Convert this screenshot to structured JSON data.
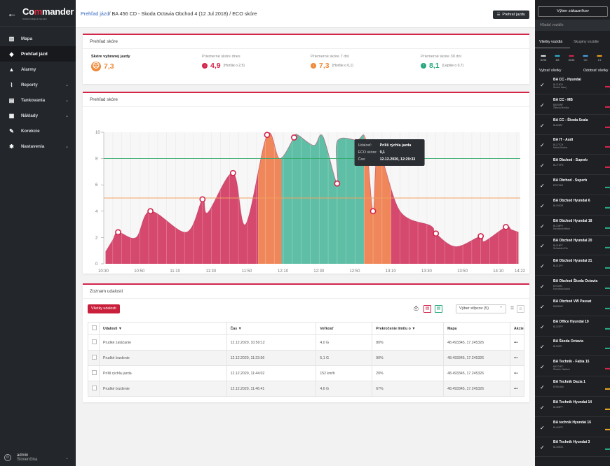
{
  "sidebar": {
    "brand_a": "Co",
    "brand_r": "m",
    "brand_b": "mander",
    "tagline": "Global Intelligent Operator",
    "items": [
      {
        "label": "Mapa",
        "icon": "map-icon"
      },
      {
        "label": "Prehľad jázd",
        "icon": "car-icon"
      },
      {
        "label": "Alarmy",
        "icon": "bell-icon"
      },
      {
        "label": "Reporty",
        "icon": "chart-icon"
      },
      {
        "label": "Tankovania",
        "icon": "fuel-icon"
      },
      {
        "label": "Náklady",
        "icon": "document-icon"
      },
      {
        "label": "Korekcie",
        "icon": "wrench-icon"
      },
      {
        "label": "Nastavenia",
        "icon": "gear-icon"
      }
    ],
    "user": {
      "name": "admin",
      "locale": "Slovenčina"
    }
  },
  "topbar": {
    "crumb_link": "Prehľad jázd",
    "crumb_rest": " / BA 456 CD - Skoda Octavia Obchod 4 (12 Jul 2018) / ECO skóre",
    "replay_button": "Prehrať jazdu"
  },
  "score_card": {
    "title": "Prehľad skóre",
    "cols": [
      {
        "label": "Skóre vybranej jazdy",
        "value": "7,3",
        "note": "",
        "color": "#ef8a3a"
      },
      {
        "label": "Priemerné skóre dnes",
        "value": "4,9",
        "note": "(Horšie o 2,5)",
        "color": "#d3244a"
      },
      {
        "label": "Priemerné skóre 7 dní",
        "value": "7,3",
        "note": "(Horšie o 0,1)",
        "color": "#ef8a3a"
      },
      {
        "label": "Priemerné skóre 30 dní",
        "value": "8,1",
        "note": "(Lepšie o 0,7)",
        "color": "#27a77e"
      }
    ]
  },
  "chart_card": {
    "title": "Prehľad skóre"
  },
  "chart_data": {
    "type": "area",
    "title": "",
    "xlabel": "",
    "ylabel": "",
    "ylim": [
      0,
      10
    ],
    "yticks": [
      0,
      2,
      4,
      6,
      8,
      10
    ],
    "xticks": [
      "10:30",
      "10:50",
      "11:10",
      "11:30",
      "11:50",
      "12:10",
      "12:30",
      "12:50",
      "13:10",
      "13:30",
      "13:50",
      "14:10",
      "14:22"
    ],
    "thresholds": [
      {
        "value": 8,
        "color": "#33a86b"
      },
      {
        "value": 5,
        "color": "#f0a060"
      }
    ],
    "markers": [
      {
        "x": "10:38",
        "y": 2.4
      },
      {
        "x": "10:56",
        "y": 4.0
      },
      {
        "x": "11:25",
        "y": 4.9
      },
      {
        "x": "11:42",
        "y": 6.9
      },
      {
        "x": "12:01",
        "y": 9.8
      },
      {
        "x": "12:16",
        "y": 9.6
      },
      {
        "x": "12:40",
        "y": 6.1
      },
      {
        "x": "13:00",
        "y": 4.0
      },
      {
        "x": "13:35",
        "y": 2.3
      },
      {
        "x": "14:00",
        "y": 2.1
      },
      {
        "x": "14:14",
        "y": 2.8
      }
    ],
    "tooltip": {
      "l1": "Udalosť:",
      "v1": "Príliš rýchla jazda",
      "l2": "ECO skóre:",
      "v2": "9,1",
      "l3": "Čas:",
      "v3": "12.12.2020, 12:29:33"
    },
    "colors": {
      "red": "#d6496e",
      "orange": "#f0875a",
      "teal": "#5fbfa6"
    }
  },
  "events": {
    "title": "Zoznam udalostí",
    "all_button": "Všetky udalosti",
    "columns_select": "Výber stĺpcov (5)",
    "headers": [
      "Udalosti",
      "Čas",
      "Veľkosť",
      "Prekročenie limitu o",
      "Mapa",
      "Akcie"
    ],
    "rows": [
      [
        "Prudké zatáčanie",
        "12.12.2020, 10:50:12",
        "4,0 G",
        "80%",
        "48.493345, 17.245326",
        "•••"
      ],
      [
        "Prudké brzdenie",
        "12.12.2020, 11:23:56",
        "5,1 G",
        "90%",
        "48.493345, 17.245326",
        "•••"
      ],
      [
        "Príliš rýchla jazda",
        "12.12.2020, 11:44:02",
        "152 km/h",
        "20%",
        "48.493345, 17.245326",
        "•••"
      ],
      [
        "Prudké brzdenie",
        "12.12.2020, 11:46:41",
        "4,6 G",
        "67%",
        "48.493345, 17.245326",
        "•••"
      ]
    ]
  },
  "rpanel": {
    "customers_button": "Výber zákazníkov",
    "search_placeholder": "Hľadať vozidlo",
    "tab_vehicles": "Všetky vozidlá",
    "tab_groups": "Skupiny vozidie",
    "stats": [
      "50/55",
      "8/8",
      "45/48",
      "0/0",
      "1/1"
    ],
    "select_all": "Vybrať všetky",
    "deselect_all": "Odobrať všetky",
    "vehicles": [
      {
        "name": "BA CC - Hyundai",
        "plate": "BL216DX",
        "driver": "Ševčík Matej"
      },
      {
        "name": "BA CC - MB",
        "plate": "BA006NF",
        "driver": "Žitková Monika"
      },
      {
        "name": "BA CC - Škoda Scala",
        "plate": "BL606AT",
        "driver": ""
      },
      {
        "name": "BA IT - Audi",
        "plate": "BL177CH",
        "driver": "Maťuš Mucha"
      },
      {
        "name": "BA Obchod - Superb",
        "plate": "BL7TXPS",
        "driver": ""
      },
      {
        "name": "BA Obrhod - Superb",
        "plate": "BT076KS",
        "driver": ""
      },
      {
        "name": "BA Obchod Hyundai 6",
        "plate": "BL191DR",
        "driver": ""
      },
      {
        "name": "BA Obchod Hyundai 18",
        "plate": "BL238PV",
        "driver": "Nováková Mária"
      },
      {
        "name": "BA Obchod Hyundai 20",
        "plate": "BL218PT",
        "driver": "Schneider Ela"
      },
      {
        "name": "BA Obchod Hyundai 21",
        "plate": "BL212PY",
        "driver": ""
      },
      {
        "name": "BA Obchod Škoda Octavia",
        "plate": "BT036KI",
        "driver": "Komínová Ivana"
      },
      {
        "name": "BA Obchod VW Passat",
        "plate": "BA056UF",
        "driver": ""
      },
      {
        "name": "BA Office Hyundai 19",
        "plate": "BL322PY",
        "driver": ""
      },
      {
        "name": "BA Škoda Octavia",
        "plate": "BL546TI",
        "driver": ""
      },
      {
        "name": "BA Technik - Fabia 15",
        "plate": "BA374EC",
        "driver": "Školník Vladimír"
      },
      {
        "name": "BA Technik Dacia 1",
        "plate": "BT651AM",
        "driver": ""
      },
      {
        "name": "BA Technik Hyundai 14",
        "plate": "BL485PY",
        "driver": ""
      },
      {
        "name": "BA technik Hyundai 16",
        "plate": "BL402PZ",
        "driver": ""
      },
      {
        "name": "BA Technik Hyundai 3",
        "plate": "BL185GK",
        "driver": ""
      }
    ]
  }
}
